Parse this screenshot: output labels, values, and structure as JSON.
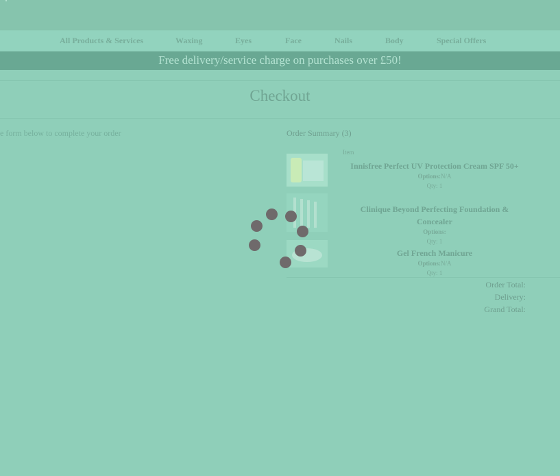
{
  "nav": {
    "items": [
      {
        "label": "All Products & Services"
      },
      {
        "label": "Waxing"
      },
      {
        "label": "Eyes"
      },
      {
        "label": "Face"
      },
      {
        "label": "Nails"
      },
      {
        "label": "Body"
      },
      {
        "label": "Special Offers"
      }
    ]
  },
  "promo": {
    "text": "Free delivery/service charge on purchases over £50!"
  },
  "page": {
    "title": "Checkout"
  },
  "form": {
    "intro": "e form below to complete your order"
  },
  "summary": {
    "title": "Order Summary (3)",
    "column_item": "Item",
    "items": [
      {
        "name": "Innisfree Perfect UV Protection Cream SPF 50+",
        "options_label": "Options:",
        "options_value": "N/A",
        "qty": "Qty: 1"
      },
      {
        "name": "Clinique Beyond Perfecting Foundation & Concealer",
        "options_label": "Options:",
        "options_value": "",
        "qty": "Qty: 1"
      },
      {
        "name": "Gel French Manicure",
        "options_label": "Options:",
        "options_value": "N/A",
        "qty": "Qty: 1"
      }
    ],
    "totals": {
      "order_total_label": "Order Total:",
      "delivery_label": "Delivery:",
      "grand_total_label": "Grand Total:"
    }
  },
  "colors": {
    "overlay": "#8fcfb9",
    "promo_bar": "#69a893",
    "spinner": "#6f6a6b"
  }
}
